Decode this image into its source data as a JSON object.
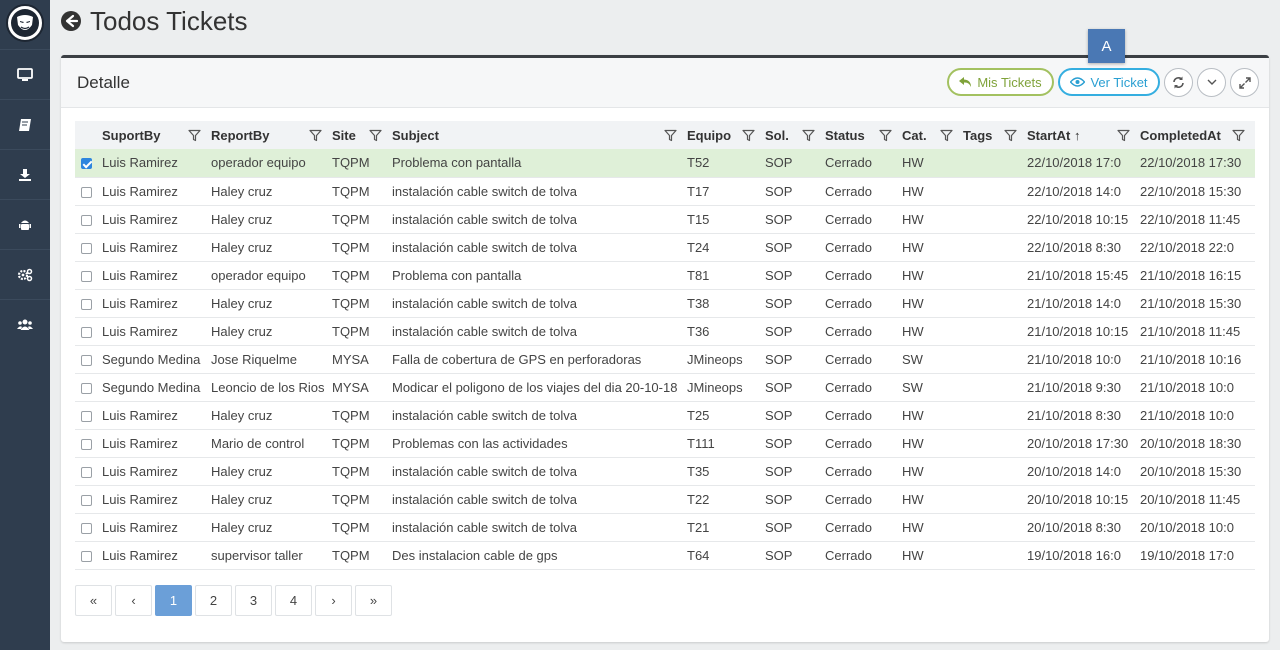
{
  "page": {
    "title": "Todos Tickets"
  },
  "card": {
    "title": "Detalle"
  },
  "toolbar": {
    "mis_tickets_label": "Mis Tickets",
    "ver_ticket_label": "Ver Ticket",
    "marker_label": "A"
  },
  "sidebar": {
    "items": [
      {
        "icon": "desktop-icon"
      },
      {
        "icon": "book-icon"
      },
      {
        "icon": "download-icon"
      },
      {
        "icon": "android-icon"
      },
      {
        "icon": "cogs-icon"
      },
      {
        "icon": "users-icon"
      }
    ]
  },
  "table": {
    "columns": [
      "SuportBy",
      "ReportBy",
      "Site",
      "Subject",
      "Equipo",
      "Sol.",
      "Status",
      "Cat.",
      "Tags",
      "StartAt ↑",
      "CompletedAt"
    ],
    "rows": [
      {
        "checked": true,
        "cells": [
          "Luis Ramirez",
          "operador equipo",
          "TQPM",
          "Problema con pantalla",
          "T52",
          "SOP",
          "Cerrado",
          "HW",
          "",
          "22/10/2018 17:0",
          "22/10/2018 17:30"
        ]
      },
      {
        "checked": false,
        "cells": [
          "Luis Ramirez",
          "Haley cruz",
          "TQPM",
          "instalación cable switch de tolva",
          "T17",
          "SOP",
          "Cerrado",
          "HW",
          "",
          "22/10/2018 14:0",
          "22/10/2018 15:30"
        ]
      },
      {
        "checked": false,
        "cells": [
          "Luis Ramirez",
          "Haley cruz",
          "TQPM",
          "instalación cable switch de tolva",
          "T15",
          "SOP",
          "Cerrado",
          "HW",
          "",
          "22/10/2018 10:15",
          "22/10/2018 11:45"
        ]
      },
      {
        "checked": false,
        "cells": [
          "Luis Ramirez",
          "Haley cruz",
          "TQPM",
          "instalación cable switch de tolva",
          "T24",
          "SOP",
          "Cerrado",
          "HW",
          "",
          "22/10/2018 8:30",
          "22/10/2018 22:0"
        ]
      },
      {
        "checked": false,
        "cells": [
          "Luis Ramirez",
          "operador equipo",
          "TQPM",
          "Problema con pantalla",
          "T81",
          "SOP",
          "Cerrado",
          "HW",
          "",
          "21/10/2018 15:45",
          "21/10/2018 16:15"
        ]
      },
      {
        "checked": false,
        "cells": [
          "Luis Ramirez",
          "Haley cruz",
          "TQPM",
          "instalación cable switch de tolva",
          "T38",
          "SOP",
          "Cerrado",
          "HW",
          "",
          "21/10/2018 14:0",
          "21/10/2018 15:30"
        ]
      },
      {
        "checked": false,
        "cells": [
          "Luis Ramirez",
          "Haley cruz",
          "TQPM",
          "instalación cable switch de tolva",
          "T36",
          "SOP",
          "Cerrado",
          "HW",
          "",
          "21/10/2018 10:15",
          "21/10/2018 11:45"
        ]
      },
      {
        "checked": false,
        "cells": [
          "Segundo Medina",
          "Jose Riquelme",
          "MYSA",
          "Falla de cobertura de GPS en perforadoras",
          "JMineops",
          "SOP",
          "Cerrado",
          "SW",
          "",
          "21/10/2018 10:0",
          "21/10/2018 10:16"
        ]
      },
      {
        "checked": false,
        "cells": [
          "Segundo Medina",
          "Leoncio de los Rios",
          "MYSA",
          "Modicar el poligono de los viajes del dia 20-10-18",
          "JMineops",
          "SOP",
          "Cerrado",
          "SW",
          "",
          "21/10/2018 9:30",
          "21/10/2018 10:0"
        ]
      },
      {
        "checked": false,
        "cells": [
          "Luis Ramirez",
          "Haley cruz",
          "TQPM",
          "instalación cable switch de tolva",
          "T25",
          "SOP",
          "Cerrado",
          "HW",
          "",
          "21/10/2018 8:30",
          "21/10/2018 10:0"
        ]
      },
      {
        "checked": false,
        "cells": [
          "Luis Ramirez",
          "Mario de control",
          "TQPM",
          "Problemas con las actividades",
          "T111",
          "SOP",
          "Cerrado",
          "HW",
          "",
          "20/10/2018 17:30",
          "20/10/2018 18:30"
        ]
      },
      {
        "checked": false,
        "cells": [
          "Luis Ramirez",
          "Haley cruz",
          "TQPM",
          "instalación cable switch de tolva",
          "T35",
          "SOP",
          "Cerrado",
          "HW",
          "",
          "20/10/2018 14:0",
          "20/10/2018 15:30"
        ]
      },
      {
        "checked": false,
        "cells": [
          "Luis Ramirez",
          "Haley cruz",
          "TQPM",
          "instalación cable switch de tolva",
          "T22",
          "SOP",
          "Cerrado",
          "HW",
          "",
          "20/10/2018 10:15",
          "20/10/2018 11:45"
        ]
      },
      {
        "checked": false,
        "cells": [
          "Luis Ramirez",
          "Haley cruz",
          "TQPM",
          "instalación cable switch de tolva",
          "T21",
          "SOP",
          "Cerrado",
          "HW",
          "",
          "20/10/2018 8:30",
          "20/10/2018 10:0"
        ]
      },
      {
        "checked": false,
        "cells": [
          "Luis Ramirez",
          "supervisor taller",
          "TQPM",
          "Des instalacion cable de gps",
          "T64",
          "SOP",
          "Cerrado",
          "HW",
          "",
          "19/10/2018 16:0",
          "19/10/2018 17:0"
        ]
      }
    ]
  },
  "pagination": {
    "buttons": [
      "«",
      "‹",
      "1",
      "2",
      "3",
      "4",
      "›",
      "»"
    ],
    "active": "1"
  },
  "colors": {
    "sidebar": "#2f3d4e",
    "selected_row": "#dff0d8",
    "mis_tickets": "#7fa239",
    "ver_ticket": "#2a9fd2",
    "active_page": "#6b9fd8"
  }
}
